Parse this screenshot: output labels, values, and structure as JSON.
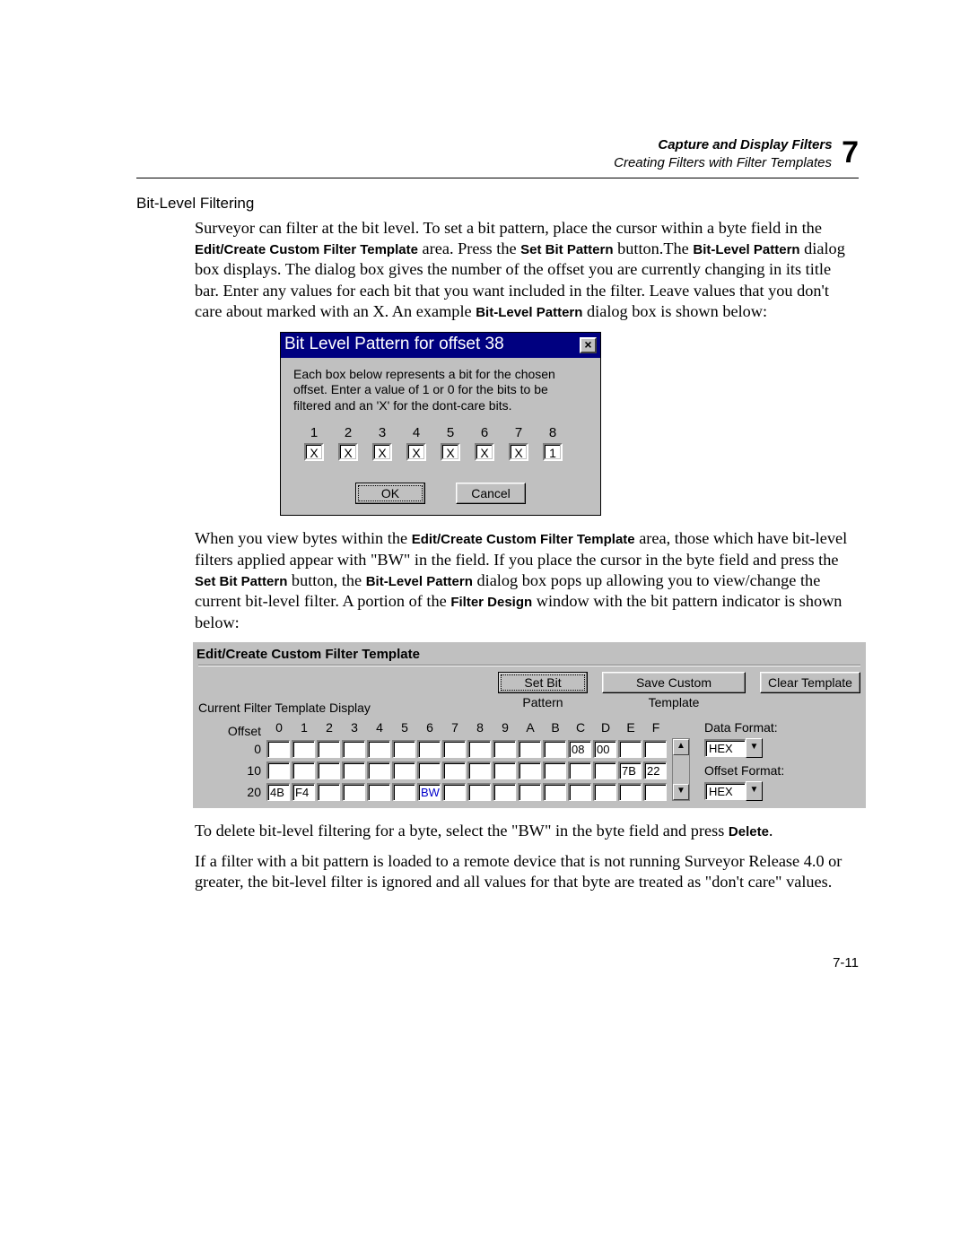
{
  "header": {
    "line1": "Capture and Display Filters",
    "line2": "Creating Filters with Filter Templates",
    "chapter": "7"
  },
  "section_title": "Bit-Level Filtering",
  "para1_a": "Surveyor can filter at the bit level. To set a bit pattern, place the cursor within a byte field in the ",
  "para1_b": "Edit/Create Custom Filter Template",
  "para1_c": " area. Press the ",
  "para1_d": "Set Bit Pattern",
  "para1_e": " button.The ",
  "para1_f": "Bit-Level Pattern",
  "para1_g": " dialog box displays. The dialog box gives the number of the offset you are currently changing in its title bar. Enter any values for each bit that you want included in the filter. Leave values that you don't care about marked with an X. An example ",
  "para1_h": "Bit-Level Pattern",
  "para1_i": " dialog box is shown below:",
  "dialog": {
    "title": "Bit Level Pattern for offset 38",
    "close": "×",
    "text": "Each box below represents a bit for the chosen offset. Enter a value of 1 or 0 for the bits to be filtered and an 'X' for the dont-care bits.",
    "labels": [
      "1",
      "2",
      "3",
      "4",
      "5",
      "6",
      "7",
      "8"
    ],
    "values": [
      "X",
      "X",
      "X",
      "X",
      "X",
      "X",
      "X",
      "1"
    ],
    "ok": "OK",
    "cancel": "Cancel"
  },
  "para2_a": "When you view bytes within the ",
  "para2_b": "Edit/Create Custom Filter Template",
  "para2_c": " area, those which have bit-level filters applied appear with \"BW\" in the field. If you place the cursor in the byte field and press the ",
  "para2_d": "Set Bit Pattern",
  "para2_e": " button, the ",
  "para2_f": "Bit-Level Pattern",
  "para2_g": " dialog box pops up allowing you to view/change the current bit-level filter. A portion of the ",
  "para2_h": "Filter Design",
  "para2_i": " window with the bit pattern indicator is shown below:",
  "panel": {
    "group": "Edit/Create Custom Filter Template",
    "btn_set": "Set Bit Pattern",
    "btn_save": "Save Custom Template",
    "btn_clear": "Clear Template",
    "subgroup": "Current Filter Template Display",
    "offset_label": "Offset",
    "cols": [
      "0",
      "1",
      "2",
      "3",
      "4",
      "5",
      "6",
      "7",
      "8",
      "9",
      "A",
      "B",
      "C",
      "D",
      "E",
      "F"
    ],
    "rows": [
      {
        "label": "0",
        "cells": [
          "",
          "",
          "",
          "",
          "",
          "",
          "",
          "",
          "",
          "",
          "",
          "",
          "08",
          "00",
          "",
          ""
        ]
      },
      {
        "label": "10",
        "cells": [
          "",
          "",
          "",
          "",
          "",
          "",
          "",
          "",
          "",
          "",
          "",
          "",
          "",
          "",
          "7B",
          "22"
        ]
      },
      {
        "label": "20",
        "cells": [
          "4B",
          "F4",
          "",
          "",
          "",
          "",
          "BW",
          "",
          "",
          "",
          "",
          "",
          "",
          "",
          "",
          ""
        ]
      }
    ],
    "data_fmt_label": "Data Format:",
    "offset_fmt_label": "Offset Format:",
    "hex": "HEX",
    "up": "▲",
    "down": "▼"
  },
  "para3_a": "To delete bit-level filtering for a byte, select the \"BW\" in the byte field and press ",
  "para3_b": "Delete",
  "para3_c": ".",
  "para4": "If a filter with a bit pattern is loaded to a remote device that is not running Surveyor Release 4.0 or greater, the bit-level filter is ignored and all values for that byte are treated as \"don't care\" values.",
  "pagenum": "7-11"
}
